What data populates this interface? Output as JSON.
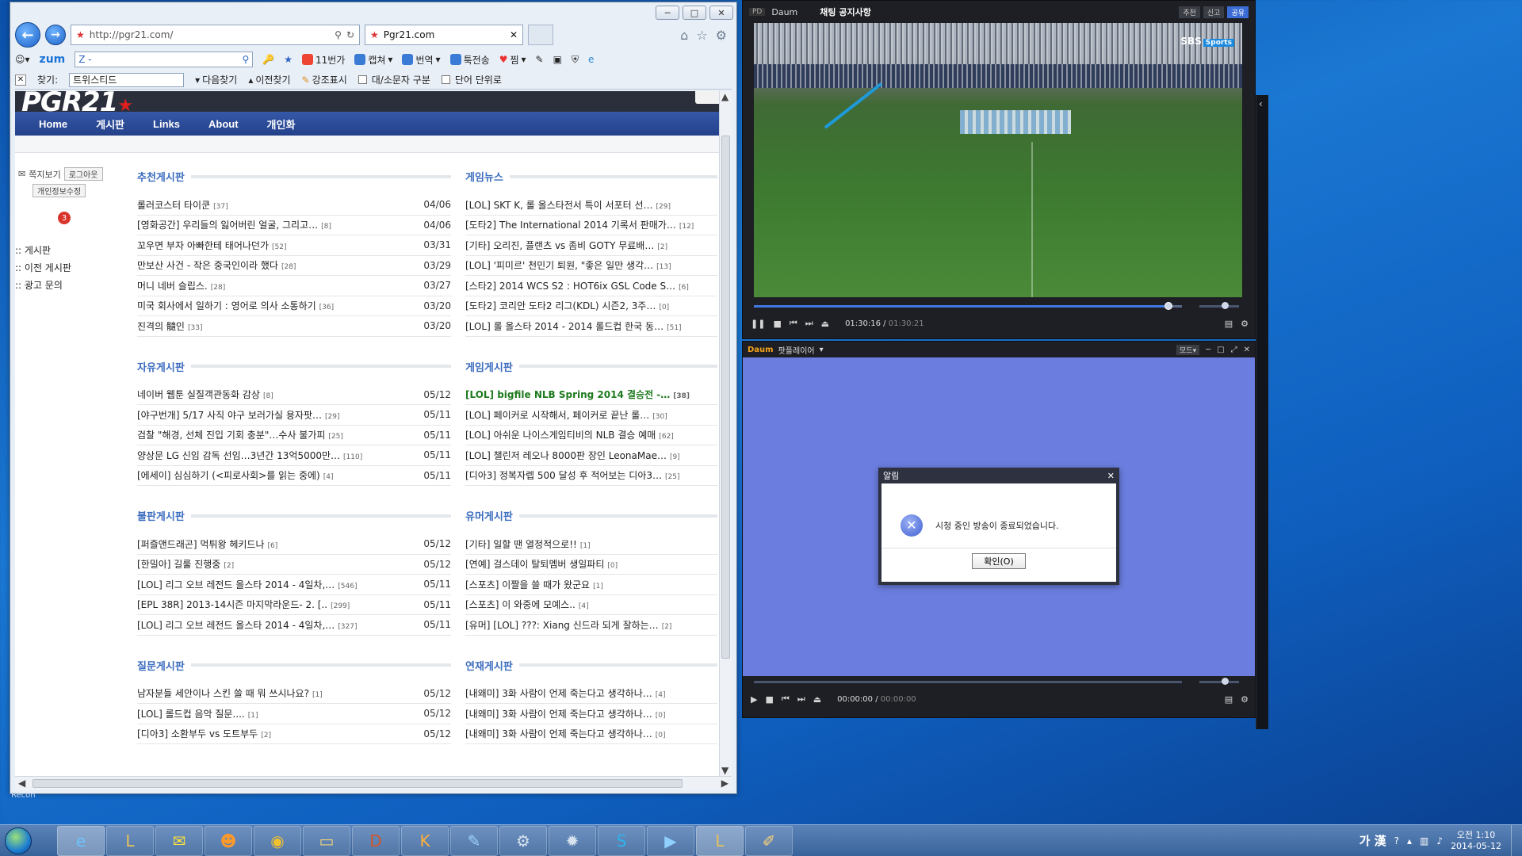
{
  "browser": {
    "url": "http://pgr21.com/",
    "tab_title": "Pgr21.com",
    "window_buttons": [
      "─",
      "□",
      "✕"
    ],
    "toolbar": {
      "zum": "zum",
      "search_placeholder": "Z -",
      "items": [
        "11번가",
        "캡쳐",
        "번역",
        "툭전송",
        "찜"
      ]
    },
    "findbar": {
      "label": "찾기:",
      "value": "트위스티드",
      "next": "다음찾기",
      "prev": "이전찾기",
      "highlight": "강조표시",
      "case": "대/소문자 구분",
      "word": "단어 단위로"
    }
  },
  "site": {
    "logo": "PGR21",
    "menu": [
      "Home",
      "게시판",
      "Links",
      "About",
      "개인화"
    ],
    "sidebar": {
      "message": "쪽지보기",
      "logout": "로그아웃",
      "edit_info": "개인정보수정",
      "badge": "3",
      "links": [
        ":: 게시판",
        ":: 이전 게시판",
        ":: 광고 문의"
      ]
    },
    "boards": [
      {
        "title": "추천게시판",
        "rows": [
          {
            "t": "롤러코스터 타이쿤",
            "c": "[37]",
            "d": "04/06"
          },
          {
            "t": "[영화공간] 우리들의 잃어버린 얼굴, 그리고…",
            "c": "[8]",
            "d": "04/06"
          },
          {
            "t": "꼬우면 부자 아빠한테 태어나던가",
            "c": "[52]",
            "d": "03/31"
          },
          {
            "t": "만보산 사건 - 작은 중국인이라 했다",
            "c": "[28]",
            "d": "03/29"
          },
          {
            "t": "머니 네버 슬립스.",
            "c": "[28]",
            "d": "03/27"
          },
          {
            "t": "미국 회사에서 일하기 : 영어로 의사 소통하기",
            "c": "[36]",
            "d": "03/20"
          },
          {
            "t": "진격의 髓인",
            "c": "[33]",
            "d": "03/20"
          }
        ]
      },
      {
        "title": "게임뉴스",
        "rows": [
          {
            "t": "[LOL] SKT K, 롤 올스타전서 특이 서포터 선…",
            "c": "[29]"
          },
          {
            "t": "[도타2] The International 2014 기록서 판매가…",
            "c": "[12]"
          },
          {
            "t": "[기타] 오리진, 플랜츠 vs 좀비 GOTY 무료배…",
            "c": "[2]"
          },
          {
            "t": "[LOL] '피미르' 천민기 퇴원, \"좋은 일만 생각…",
            "c": "[13]"
          },
          {
            "t": "[스타2] 2014 WCS S2 : HOT6ix GSL Code S…",
            "c": "[6]"
          },
          {
            "t": "[도타2] 코리안 도타2 리그(KDL) 시즌2, 3주…",
            "c": "[0]"
          },
          {
            "t": "[LOL] 롤 올스타 2014 - 2014 롤드컵 한국 동…",
            "c": "[51]"
          }
        ]
      },
      {
        "title": "자유게시판",
        "rows": [
          {
            "t": "네이버 웹툰 실질객관동화 감상",
            "c": "[8]",
            "d": "05/12"
          },
          {
            "t": "[야구번개] 5/17 사직 야구 보러가실 용자팟…",
            "c": "[29]",
            "d": "05/11"
          },
          {
            "t": "검찰 \"해경, 선체 진입 기회 충분\"…수사 불가피",
            "c": "[25]",
            "d": "05/11"
          },
          {
            "t": "양상문 LG 신임 감독 선임…3년간 13억5000만…",
            "c": "[110]",
            "d": "05/11"
          },
          {
            "t": "[에세이] 심심하기 (<피로사회>를 읽는 중에)",
            "c": "[4]",
            "d": "05/11"
          }
        ]
      },
      {
        "title": "게임게시판",
        "rows": [
          {
            "t": "[LOL] bigfile NLB Spring 2014 결승전 -…",
            "c": "[38]",
            "hl": true
          },
          {
            "t": "[LOL] 페이커로 시작해서, 페이커로 끝난 롤…",
            "c": "[30]"
          },
          {
            "t": "[LOL] 아쉬운 나이스게임티비의 NLB 결승 예매",
            "c": "[62]"
          },
          {
            "t": "[LOL] 챌린저 레오나 8000판 장인 LeonaMae…",
            "c": "[9]"
          },
          {
            "t": "[디아3] 정복자렙 500 달성 후 적어보는 디아3…",
            "c": "[25]"
          }
        ]
      },
      {
        "title": "불판게시판",
        "rows": [
          {
            "t": "[퍼즐앤드래곤] 먹튀왕 헤키드나",
            "c": "[6]",
            "d": "05/12"
          },
          {
            "t": "[한밀아] 길룰 진행중",
            "c": "[2]",
            "d": "05/12"
          },
          {
            "t": "[LOL] 리그 오브 레전드 올스타 2014 - 4일차,…",
            "c": "[546]",
            "d": "05/11"
          },
          {
            "t": "[EPL 38R] 2013-14시즌 마지막라운드- 2. [..",
            "c": "[299]",
            "d": "05/11"
          },
          {
            "t": "[LOL] 리그 오브 레전드 올스타 2014 - 4일차,…",
            "c": "[327]",
            "d": "05/11"
          }
        ]
      },
      {
        "title": "유머게시판",
        "rows": [
          {
            "t": "[기타] 일할 땐 열정적으로!!",
            "c": "[1]"
          },
          {
            "t": "[연예] 걸스데이 탈퇴멤버 생일파티",
            "c": "[0]"
          },
          {
            "t": "[스포츠] 이짤을 쓸 때가 왔군요",
            "c": "[1]"
          },
          {
            "t": "[스포츠] 이 와중에 모예스..",
            "c": "[4]"
          },
          {
            "t": "[유머] [LOL] ???: Xiang 신드라 되게 잘하는…",
            "c": "[2]"
          }
        ]
      },
      {
        "title": "질문게시판",
        "rows": [
          {
            "t": "남자분들 세안이나 스킨 쓸 때 뭐 쓰시나요?",
            "c": "[1]",
            "d": "05/12"
          },
          {
            "t": "[LOL] 롤드컵 음악 질문....",
            "c": "[1]",
            "d": "05/12"
          },
          {
            "t": "[디아3] 소환부두 vs 도트부두",
            "c": "[2]",
            "d": "05/12"
          }
        ]
      },
      {
        "title": "연재게시판",
        "rows": [
          {
            "t": "[내왜미] 3화 사람이 언제 죽는다고 생각하나…",
            "c": "[4]"
          },
          {
            "t": "[내왜미] 3화 사람이 언제 죽는다고 생각하나…",
            "c": "[0]"
          },
          {
            "t": "[내왜미] 3화 사람이 언제 죽는다고 생각하나…",
            "c": "[0]"
          }
        ]
      }
    ]
  },
  "player_top": {
    "pd": "PD",
    "channel": "Daum",
    "title": "채팅 공지사항",
    "buttons": [
      "추천",
      "신고",
      "공유"
    ],
    "logo": "SBS",
    "logo_sub": "Sports",
    "time_current": "01:30:16",
    "time_total": "01:30:21",
    "progress": 0.96
  },
  "player_bottom": {
    "title": "팟플레이어",
    "brand": "Daum",
    "mode": "모드",
    "time_current": "00:00:00",
    "time_total": "00:00:00"
  },
  "dialog": {
    "title": "알림",
    "message": "시청 중인 방송이 종료되었습니다.",
    "ok": "확인(O)"
  },
  "taskbar": {
    "ime": "가 漢",
    "time": "오전 1:10",
    "date": "2014-05-12",
    "desktop_label": "Recon"
  },
  "colors": {
    "menu_bar": "#2a4592",
    "board_title": "#3b6cbf",
    "player_screen": "#6b7ee0",
    "taskbar": "#4a74ab"
  }
}
